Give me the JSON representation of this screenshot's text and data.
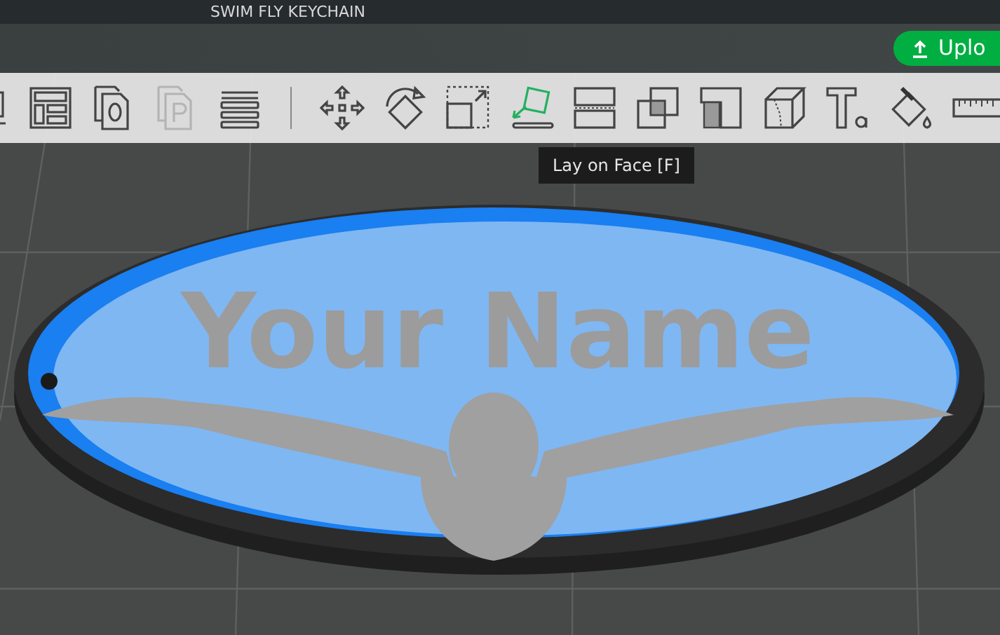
{
  "window": {
    "title": "SWIM FLY KEYCHAIN"
  },
  "upload_button": {
    "label": "Uplo"
  },
  "toolbar": [
    {
      "kind": "tool",
      "selected": false,
      "disabled": false
    },
    {
      "kind": "tool",
      "selected": false,
      "disabled": false
    },
    {
      "kind": "tool",
      "selected": false,
      "disabled": false
    },
    {
      "kind": "tool",
      "selected": false,
      "disabled": true
    },
    {
      "kind": "tool",
      "selected": false,
      "disabled": false
    },
    {
      "kind": "separator"
    },
    {
      "kind": "tool",
      "selected": false,
      "disabled": false
    },
    {
      "kind": "tool",
      "selected": false,
      "disabled": false
    },
    {
      "kind": "tool",
      "selected": false,
      "disabled": false
    },
    {
      "kind": "tool",
      "selected": true,
      "disabled": false
    },
    {
      "kind": "tool",
      "selected": false,
      "disabled": false
    },
    {
      "kind": "tool",
      "selected": false,
      "disabled": false
    },
    {
      "kind": "tool",
      "selected": false,
      "disabled": false
    },
    {
      "kind": "tool",
      "selected": false,
      "disabled": false
    },
    {
      "kind": "tool",
      "selected": false,
      "disabled": false
    },
    {
      "kind": "tool",
      "selected": false,
      "disabled": false
    },
    {
      "kind": "tool",
      "selected": false,
      "disabled": false
    }
  ],
  "tooltip": {
    "text": "Lay on Face [F]"
  },
  "model": {
    "engraved_text": "Your Name"
  }
}
